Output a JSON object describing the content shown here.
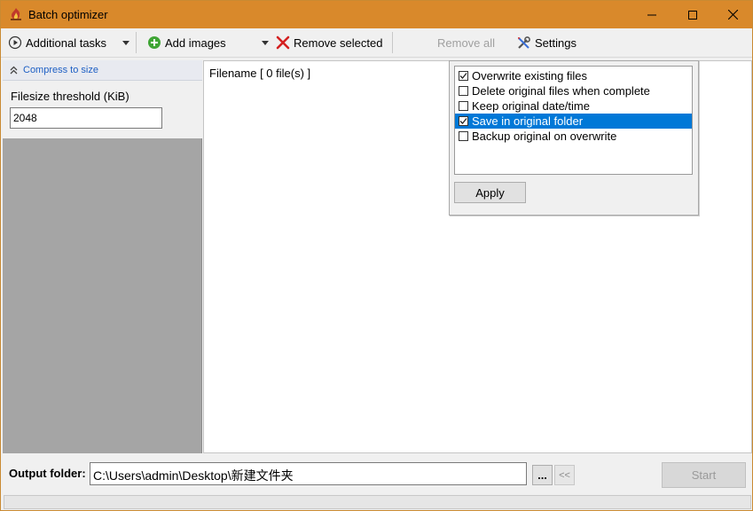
{
  "window": {
    "title": "Batch optimizer",
    "accent_color": "#d9892b"
  },
  "toolbar": {
    "additional_tasks": "Additional tasks",
    "add_images": "Add images",
    "remove_selected": "Remove selected",
    "remove_all": "Remove all",
    "settings": "Settings"
  },
  "sidebar": {
    "section_title": "Compress to size",
    "threshold_label": "Filesize threshold (KiB)",
    "threshold_value": "2048"
  },
  "file_list": {
    "header": "Filename [ 0 file(s) ]"
  },
  "options_popup": {
    "options": [
      {
        "label": "Overwrite existing files",
        "checked": true,
        "selected": false
      },
      {
        "label": "Delete original files when complete",
        "checked": false,
        "selected": false
      },
      {
        "label": "Keep original date/time",
        "checked": false,
        "selected": false
      },
      {
        "label": "Save in original folder",
        "checked": true,
        "selected": true
      },
      {
        "label": "Backup original on overwrite",
        "checked": false,
        "selected": false
      }
    ],
    "apply_label": "Apply"
  },
  "output": {
    "label": "Output folder:",
    "path": "C:\\Users\\admin\\Desktop\\新建文件夹",
    "browse_label": "...",
    "back_label": "<<",
    "start_label": "Start"
  }
}
